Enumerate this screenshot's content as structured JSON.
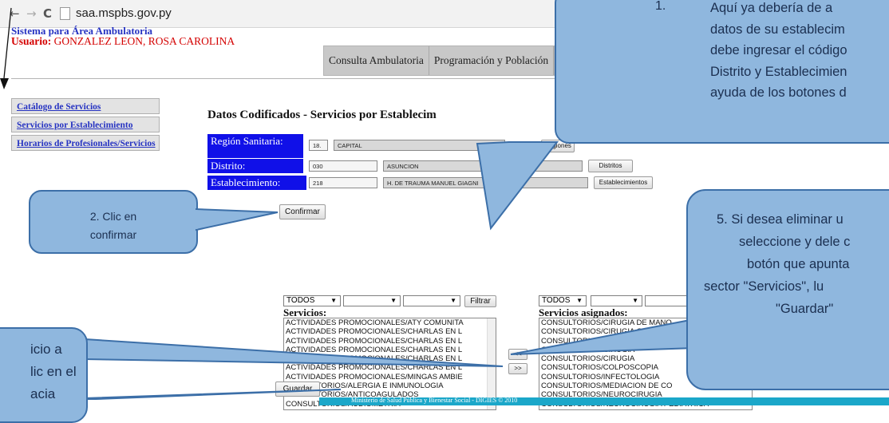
{
  "browser": {
    "url": "saa.mspbs.gov.py",
    "back_glyph": "←",
    "forward_glyph": "→",
    "reload_glyph": "C"
  },
  "header": {
    "system_name": "Sistema para Área Ambulatoria",
    "user_label": "Usuario:",
    "user_name": "GONZALEZ LEON, ROSA CAROLINA"
  },
  "menu": [
    "Consulta Ambulatoria",
    "Programación y Población"
  ],
  "sidebar": [
    {
      "label": "Catálogo de Servicios"
    },
    {
      "label": "Servicios por Establecimiento"
    },
    {
      "label": "Horarios de Profesionales/Servicios"
    }
  ],
  "main": {
    "title": "Datos Codificados - Servicios por Establecim",
    "region": {
      "label": "Región Sanitaria:",
      "code": "18.",
      "name": "CAPITAL",
      "button": "Regiones"
    },
    "distrito": {
      "label": "Distrito:",
      "code": "030",
      "name": "ASUNCION",
      "button": "Distritos"
    },
    "establecimiento": {
      "label": "Establecimiento:",
      "code": "218",
      "name": "H. DE TRAUMA MANUEL GIAGNI",
      "button": "Establecimientos"
    },
    "confirm_button": "Confirmar",
    "filter": {
      "select1": "TODOS",
      "button": "Filtrar"
    },
    "assigned_filter": {
      "select1": "TODOS"
    },
    "servicios_header": "Servicios:",
    "servicios": [
      "ACTIVIDADES PROMOCIONALES/ATY COMUNITA",
      "ACTIVIDADES PROMOCIONALES/CHARLAS EN L",
      "ACTIVIDADES PROMOCIONALES/CHARLAS EN L",
      "ACTIVIDADES PROMOCIONALES/CHARLAS EN L",
      "ACTIVIDADES PROMOCIONALES/CHARLAS EN L",
      "ACTIVIDADES PROMOCIONALES/CHARLAS EN L",
      "ACTIVIDADES PROMOCIONALES/MINGAS AMBIE",
      "CONSULTORIOS/ALERGIA E INMUNOLOGIA",
      "CONSULTORIOS/ANTICOAGULADOS",
      "CONSULTORIOS/AUDIOMETRIA"
    ],
    "asignados_header": "Servicios asignados:",
    "asignados": [
      "CONSULTORIOS/CIRUGIA DE MANO",
      "CONSULTORIOS/CIRUGIA GENERAL",
      "CONSULTORIOS/CIRUGIA",
      "CONSULTORIOS/CIRUGIA",
      "CONSULTORIOS/CIRUGIA",
      "CONSULTORIOS/COLPOSCOPIA",
      "CONSULTORIOS/INFECTOLOGIA",
      "CONSULTORIOS/MEDIACION DE CO",
      "CONSULTORIOS/NEUROCIRUGIA",
      "CONSULTORIOS/NEUROCIRUGIA PEDIATRICA"
    ],
    "move_left": "<<",
    "move_right": ">>",
    "save_button": "Guardar"
  },
  "footer": "Ministerio de Salud Pública y Bienestar Social - DIGIES © 2010",
  "callouts": {
    "c1": {
      "number": "1.",
      "lines": [
        "Aquí ya debería de a",
        "datos de su establecim",
        "debe ingresar el código",
        "Distrito y Establecimien",
        "ayuda de los botones d"
      ]
    },
    "c2": {
      "lines": [
        "2. Clic en",
        "confirmar"
      ]
    },
    "c4": {
      "lines": [
        "icio a",
        "lic en el",
        "acia"
      ]
    },
    "c5": {
      "lines": [
        "5. Si desea eliminar u",
        "seleccione y dele c",
        "botón que apunta",
        "sector \"Servicios\", lu",
        "\"Guardar\""
      ]
    }
  },
  "colors": {
    "callout_fill": "#8fb7de",
    "callout_border": "#3c6fa8",
    "label_blue": "#1010e8",
    "link_blue": "#2633c2",
    "user_red": "#d40000",
    "footer_teal": "#1ba7c9"
  }
}
